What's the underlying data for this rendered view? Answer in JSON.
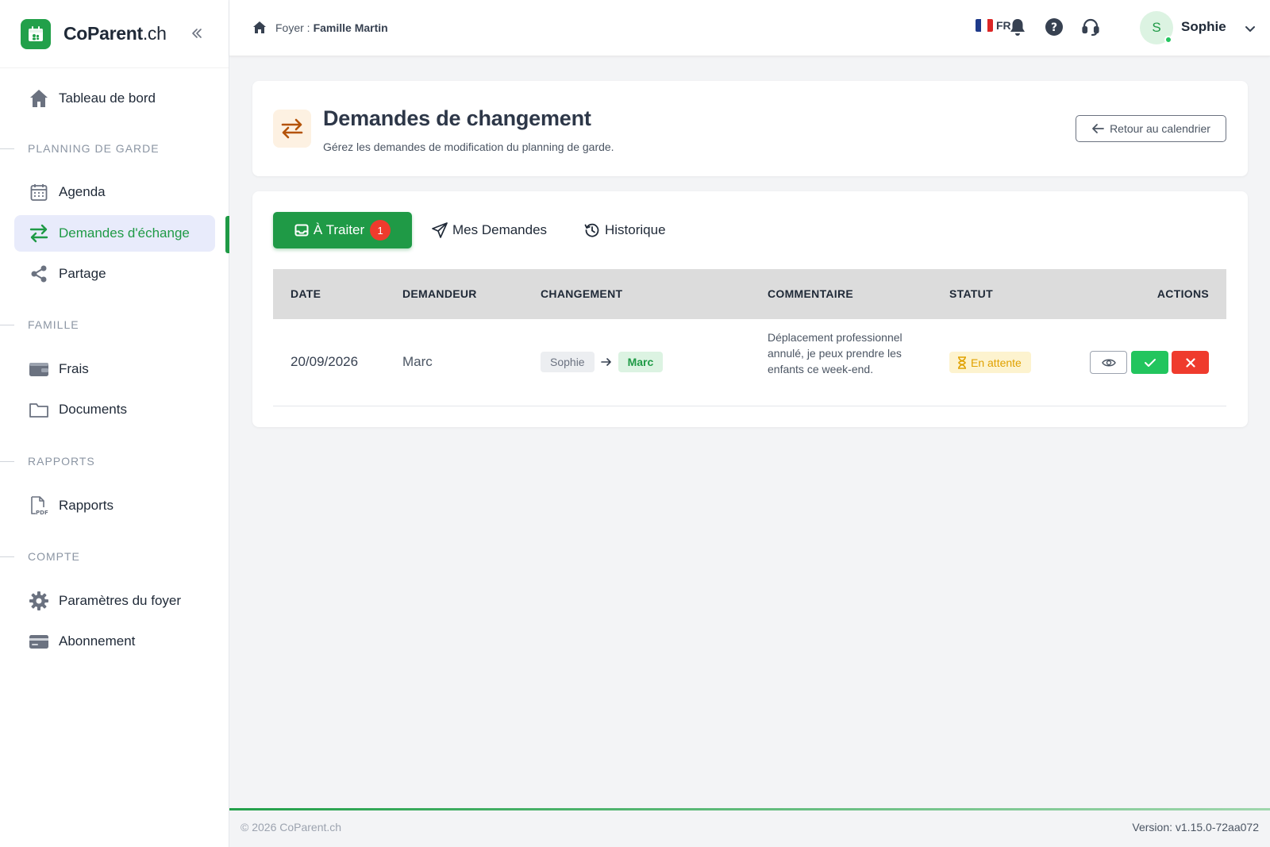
{
  "brand": {
    "name": "CoParent",
    "tld": ".ch"
  },
  "sidebar": {
    "top": {
      "label": "Tableau de bord"
    },
    "sections": {
      "planning": "PLANNING DE GARDE",
      "famille": "FAMILLE",
      "rapports": "RAPPORTS",
      "compte": "COMPTE"
    },
    "items": {
      "agenda": "Agenda",
      "demandes": "Demandes d'échange",
      "partage": "Partage",
      "frais": "Frais",
      "documents": "Documents",
      "rapports": "Rapports",
      "parametres": "Paramètres du foyer",
      "abonnement": "Abonnement"
    },
    "active_color": "#1f9a46"
  },
  "topbar": {
    "breadcrumb_prefix": "Foyer :",
    "breadcrumb_name": "Famille Martin",
    "lang": "FR",
    "user": {
      "initial": "S",
      "name": "Sophie"
    }
  },
  "header": {
    "title": "Demandes de changement",
    "subtitle": "Gérez les demandes de modification du planning de garde.",
    "back_label": "Retour au calendrier"
  },
  "tabs": {
    "traiter": {
      "label": "À Traiter",
      "count": "1"
    },
    "mes": {
      "label": "Mes Demandes"
    },
    "historique": {
      "label": "Historique"
    }
  },
  "table": {
    "columns": [
      "DATE",
      "DEMANDEUR",
      "CHANGEMENT",
      "COMMENTAIRE",
      "STATUT",
      "ACTIONS"
    ],
    "rows": [
      {
        "date": "20/09/2026",
        "requester": "Marc",
        "from": "Sophie",
        "to": "Marc",
        "comment": "Déplacement professionnel annulé, je peux prendre les enfants ce week-end.",
        "status": "En attente"
      }
    ]
  },
  "footer": {
    "copyright": "© 2026 CoParent.ch",
    "version": "Version: v1.15.0-72aa072"
  },
  "colors": {
    "primary": "#1f9a46",
    "danger": "#ef3b2d",
    "success": "#22c55e",
    "pending": "#e0a100"
  }
}
